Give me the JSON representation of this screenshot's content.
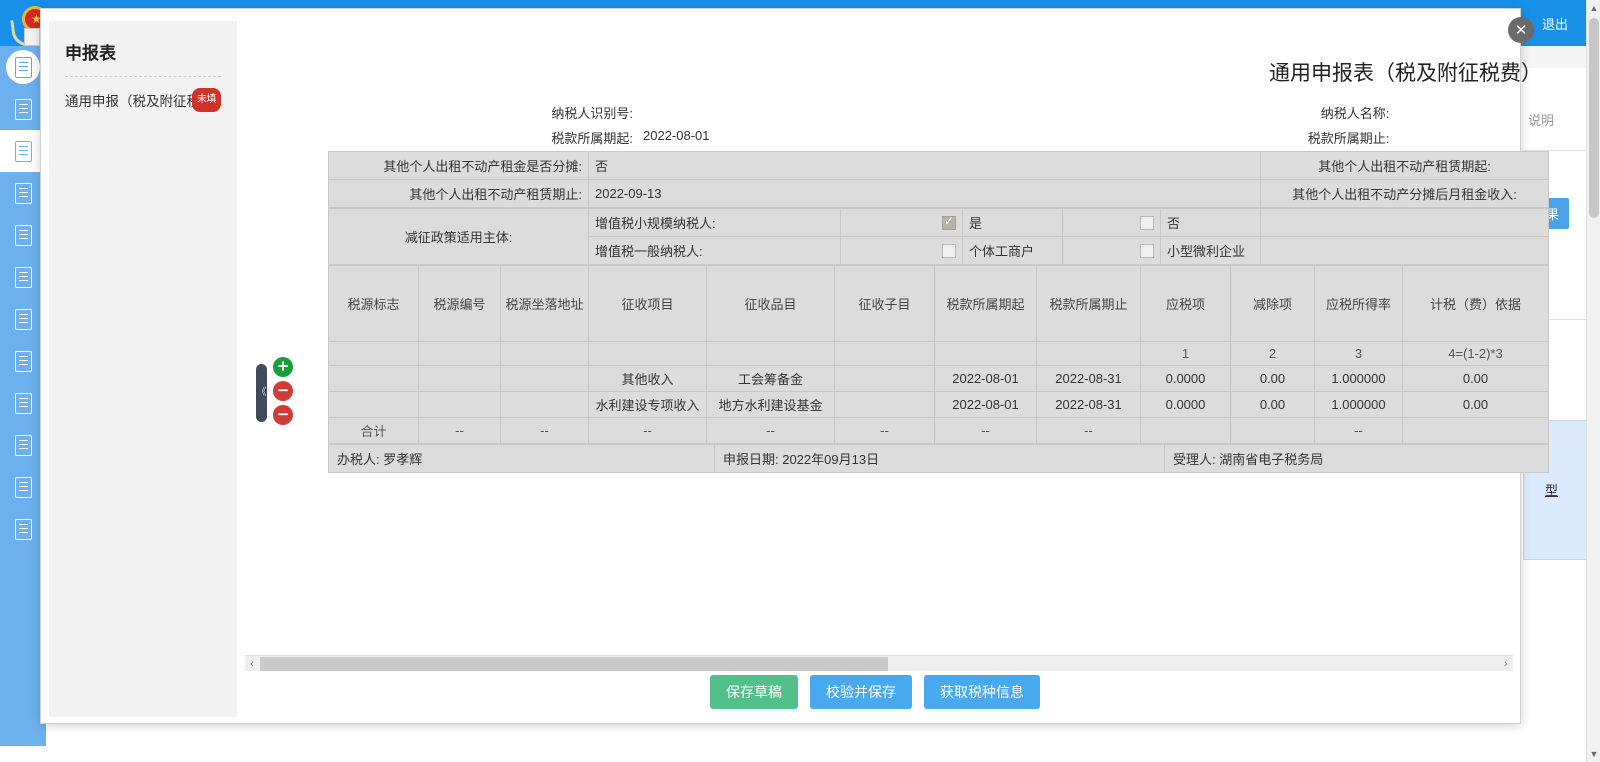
{
  "background": {
    "logout_label": "退出",
    "note_text": "说明",
    "result_button": "结果",
    "link_text": "型",
    "nav_icons": [
      "document-icon",
      "building-icon",
      "declare-icon",
      "declare-edit-icon",
      "declare-alt-icon",
      "refund-icon",
      "statement-icon",
      "invoice-icon",
      "record-icon",
      "seal-icon",
      "query-icon",
      "other-icon"
    ]
  },
  "modal": {
    "close_label": "✕",
    "sidebar": {
      "title": "申报表",
      "entry_label": "通用申报（税及附征税费）",
      "entry_badge": "未填"
    },
    "form": {
      "title": "通用申报表（税及附征税费）",
      "meta": [
        {
          "label": "纳税人识别号:",
          "value": "",
          "label_right": "纳税人名称:",
          "value_right": ""
        },
        {
          "label": "税款所属期起:",
          "value": "2022-08-01",
          "label_right": "税款所属期止:",
          "value_right": ""
        }
      ],
      "rows": [
        {
          "label": "其他个人出租不动产租金是否分摊:",
          "value": "否",
          "label_right": "其他个人出租不动产租赁期起:",
          "value_right": ""
        },
        {
          "label": "其他个人出租不动产租赁期止:",
          "value": "2022-09-13",
          "label_right": "其他个人出租不动产分摊后月租金收入:",
          "value_right": ""
        }
      ],
      "policy": {
        "label": "减征政策适用主体:",
        "lines": [
          {
            "name": "增值税小规模纳税人:",
            "options": [
              {
                "text": "是",
                "checked": true
              },
              {
                "text": "否",
                "checked": false
              }
            ]
          },
          {
            "name": "增值税一般纳税人:",
            "options": [
              {
                "text": "个体工商户",
                "checked": false
              },
              {
                "text": "小型微利企业",
                "checked": false
              }
            ]
          }
        ]
      },
      "grid": {
        "columns": [
          "税源标志",
          "税源编号",
          "税源坐落地址",
          "征收项目",
          "征收品目",
          "征收子目",
          "税款所属期起",
          "税款所属期止",
          "应税项",
          "减除项",
          "应税所得率",
          "计税（费）依据"
        ],
        "index_row": [
          "",
          "",
          "",
          "",
          "",
          "",
          "",
          "",
          "1",
          "2",
          "3",
          "4=(1-2)*3"
        ],
        "rows": [
          {
            "税源标志": "",
            "税源编号": "",
            "税源坐落地址": "",
            "征收项目": "其他收入",
            "征收品目": "工会筹备金",
            "征收子目": "",
            "税款所属期起": "2022-08-01",
            "税款所属期止": "2022-08-31",
            "应税项": "0.0000",
            "减除项": "0.00",
            "应税所得率": "1.000000",
            "计税（费）依据": "0.00"
          },
          {
            "税源标志": "",
            "税源编号": "",
            "税源坐落地址": "",
            "征收项目": "水利建设专项收入",
            "征收品目": "地方水利建设基金",
            "征收子目": "",
            "税款所属期起": "2022-08-01",
            "税款所属期止": "2022-08-31",
            "应税项": "0.0000",
            "减除项": "0.00",
            "应税所得率": "1.000000",
            "计税（费）依据": "0.00"
          }
        ],
        "total_row": [
          "合计",
          "--",
          "--",
          "--",
          "--",
          "--",
          "--",
          "--",
          "",
          "",
          "--",
          ""
        ]
      },
      "signature": {
        "handler": "办税人: 罗孝辉",
        "declare_date": "申报日期: 2022年09月13日",
        "acceptor": "受理人: 湖南省电子税务局"
      },
      "row_controls": {
        "add": "+",
        "remove": "−"
      },
      "collapse": "《"
    },
    "buttons": [
      {
        "label": "保存草稿",
        "color": "#52c08a"
      },
      {
        "label": "校验并保存",
        "color": "#49a9ef"
      },
      {
        "label": "获取税种信息",
        "color": "#49a9ef"
      }
    ],
    "hscroll": {
      "left": "‹",
      "right": "›"
    }
  }
}
